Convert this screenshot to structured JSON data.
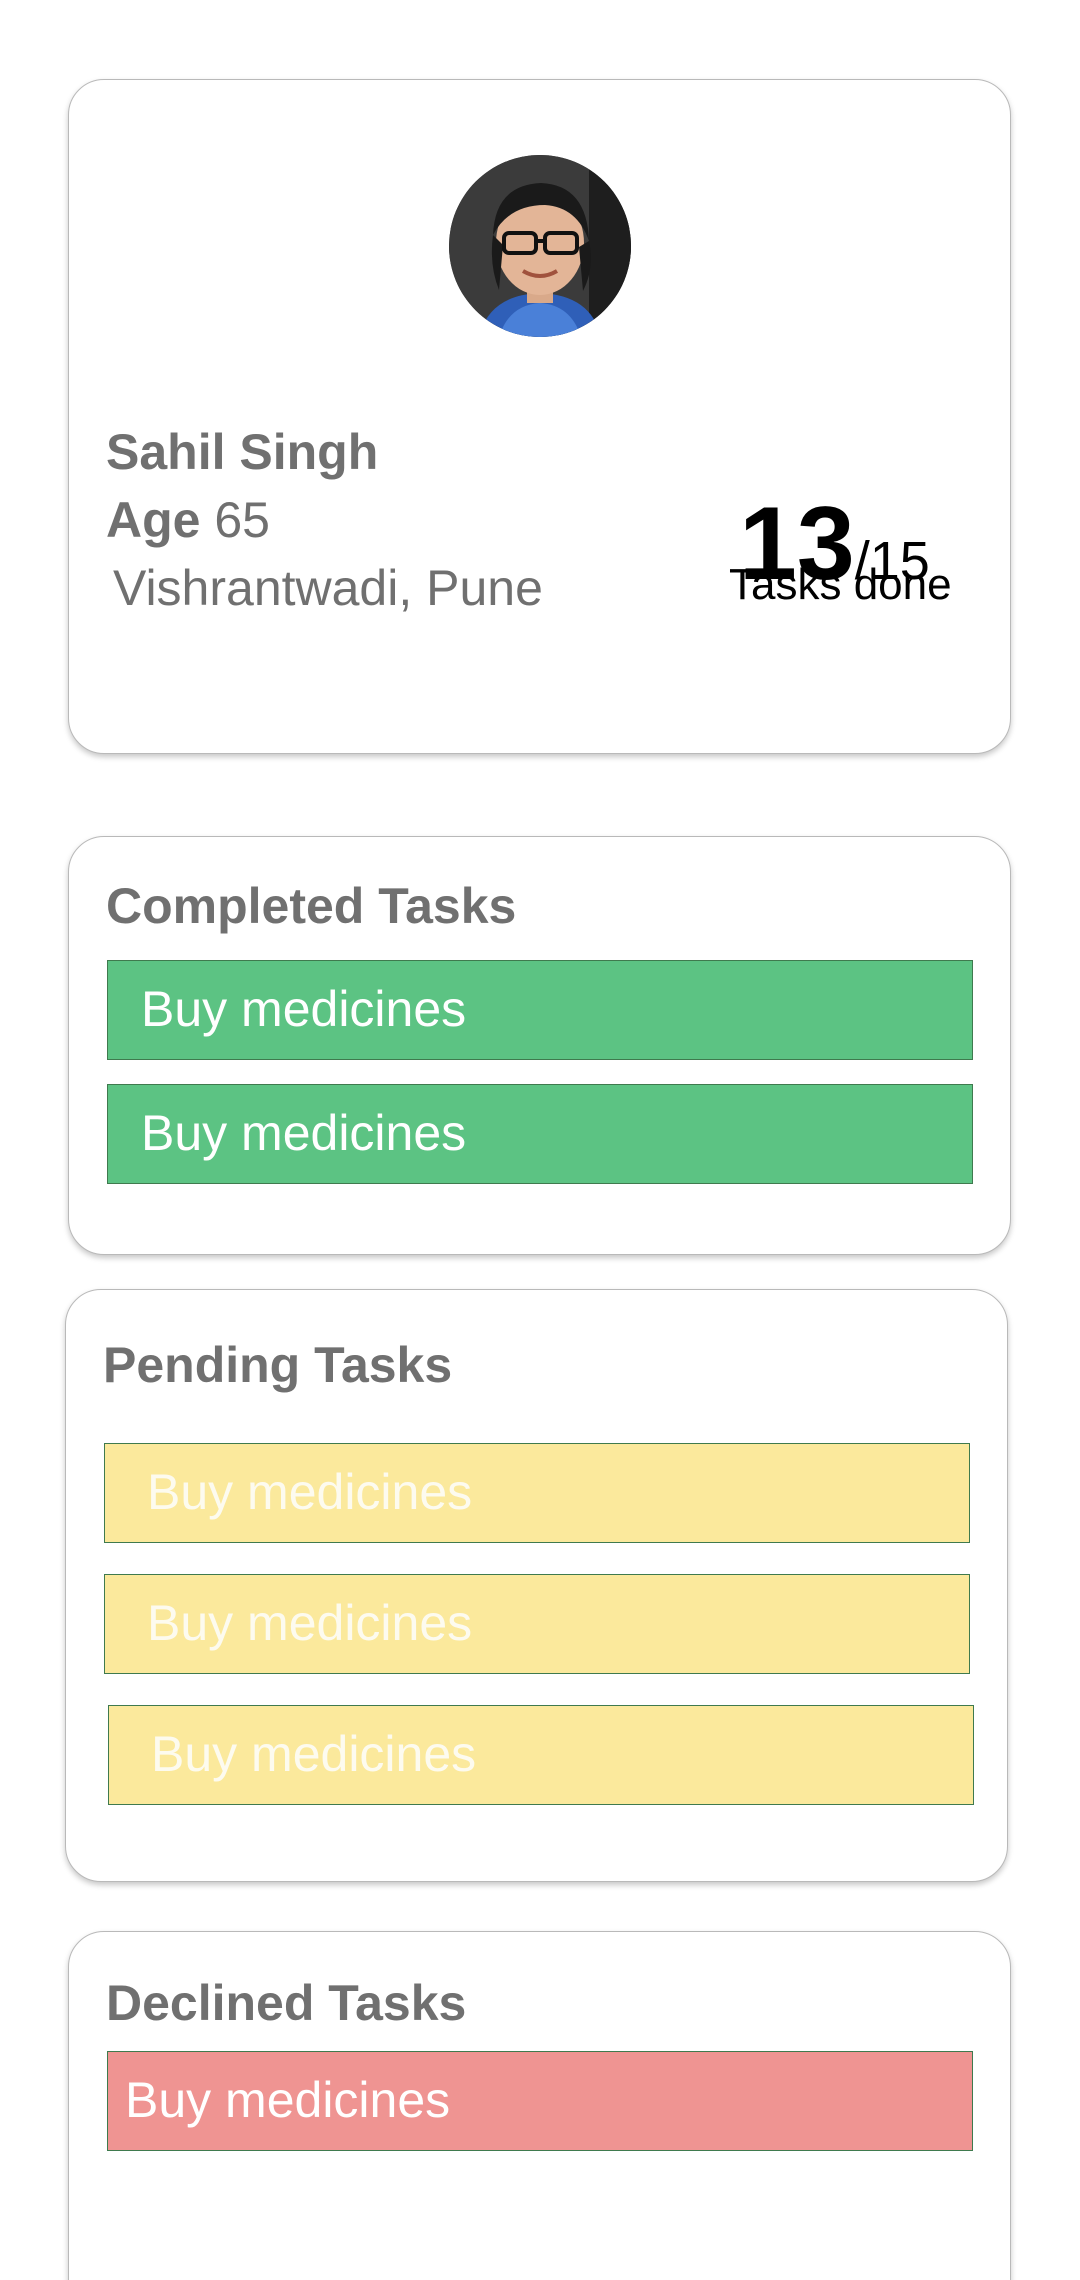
{
  "profile": {
    "name": "Sahil Singh",
    "age_label": "Age",
    "age_value": "65",
    "location": "Vishrantwadi, Pune",
    "tasks_done": "13",
    "tasks_total": "/15",
    "tasks_done_label": "Tasks done",
    "avatar_icon": "user-avatar-photo"
  },
  "completed": {
    "title": "Completed Tasks",
    "items": [
      {
        "label": "Buy medicines"
      },
      {
        "label": "Buy medicines"
      }
    ]
  },
  "pending": {
    "title": "Pending Tasks",
    "items": [
      {
        "label": "Buy medicines"
      },
      {
        "label": "Buy medicines"
      },
      {
        "label": "Buy medicines"
      }
    ]
  },
  "declined": {
    "title": "Declined Tasks",
    "items": [
      {
        "label": "Buy medicines"
      }
    ]
  },
  "colors": {
    "completed": "#5cc383",
    "pending": "#fbe99c",
    "declined": "#ef9492",
    "text_grey": "#707070"
  }
}
